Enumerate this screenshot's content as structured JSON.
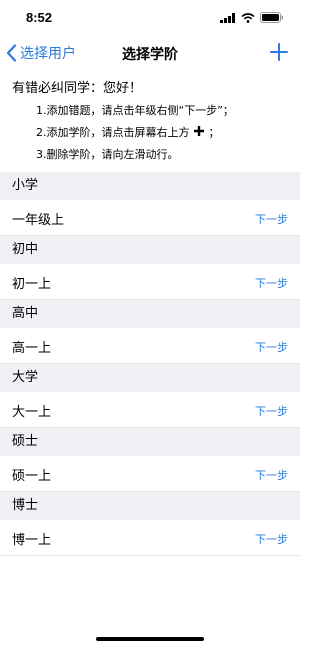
{
  "status_bar": {
    "time": "8:52"
  },
  "nav": {
    "back_label": "选择用户",
    "title": "选择学阶",
    "add_icon": "plus-icon"
  },
  "intro": {
    "greeting": "有错必纠同学：您好！",
    "step1": "1.添加错题，请点击年级右侧“下一步”；",
    "step2_before": "2.添加学阶，请点击屏幕右上方",
    "step2_after": "；",
    "step3": "3.删除学阶，请向左滑动行。"
  },
  "sections": [
    {
      "header": "小学",
      "row": {
        "label": "一年级上",
        "action": "下一步"
      }
    },
    {
      "header": "初中",
      "row": {
        "label": "初一上",
        "action": "下一步"
      }
    },
    {
      "header": "高中",
      "row": {
        "label": "高一上",
        "action": "下一步"
      }
    },
    {
      "header": "大学",
      "row": {
        "label": "大一上",
        "action": "下一步"
      }
    },
    {
      "header": "硕士",
      "row": {
        "label": "硕一上",
        "action": "下一步"
      }
    },
    {
      "header": "博士",
      "row": {
        "label": "博一上",
        "action": "下一步"
      }
    }
  ],
  "colors": {
    "accent": "#2a7ae2",
    "section_bg": "#efeff4"
  }
}
